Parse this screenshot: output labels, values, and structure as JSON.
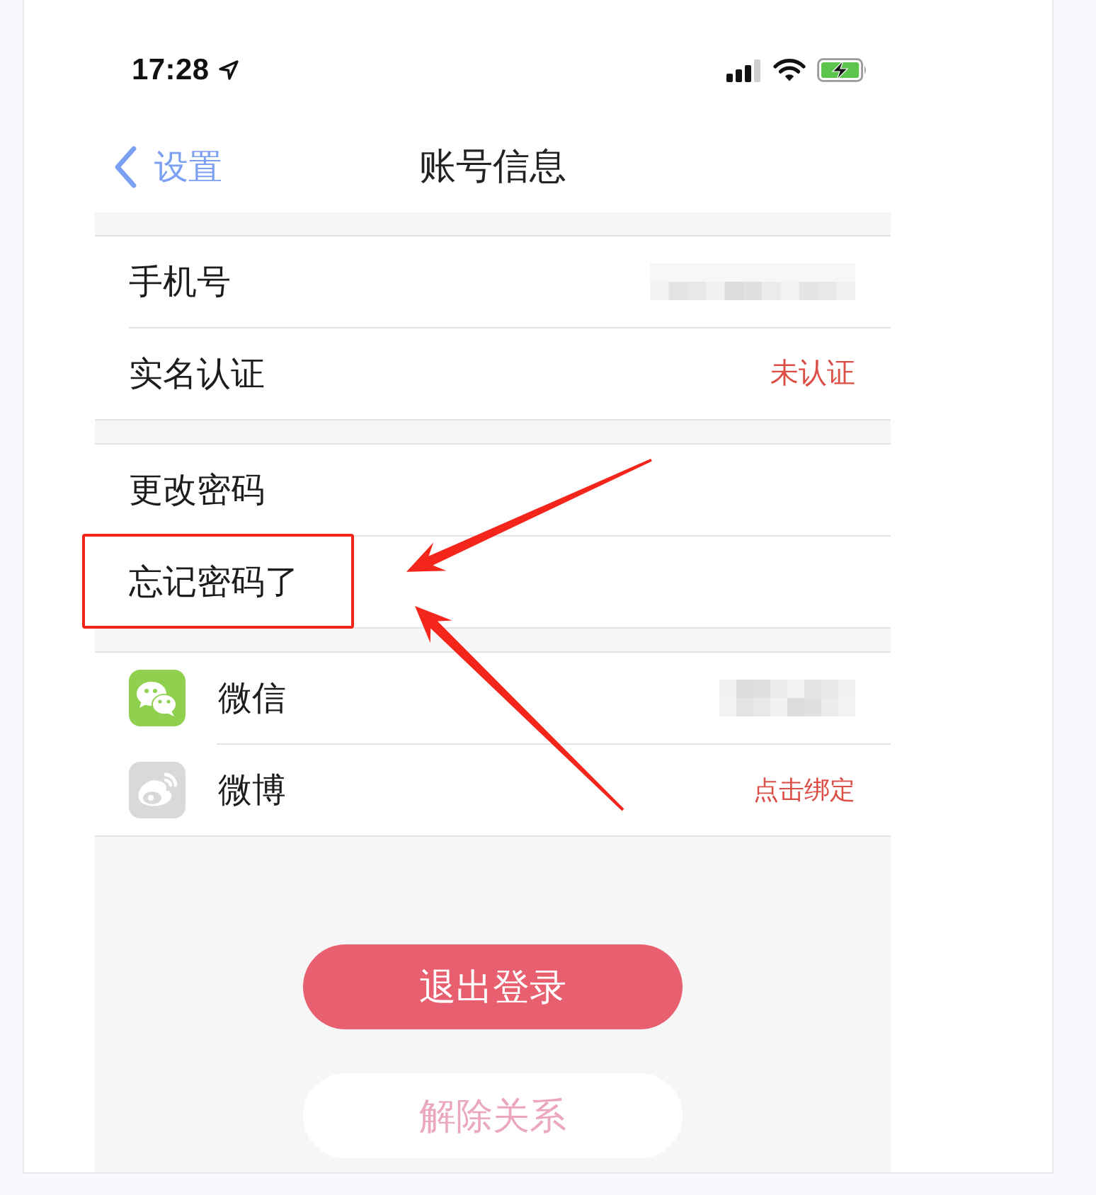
{
  "status_bar": {
    "time": "17:28"
  },
  "nav_bar": {
    "back_label": "设置",
    "title": "账号信息"
  },
  "groups": [
    {
      "rows": [
        {
          "label": "手机号",
          "value": {
            "kind": "blurred"
          },
          "highlighted": false
        },
        {
          "label": "实名认证",
          "value": {
            "kind": "text",
            "text": "未认证"
          },
          "highlighted": false
        }
      ]
    },
    {
      "rows": [
        {
          "label": "更改密码",
          "highlighted": false
        },
        {
          "label": "忘记密码了",
          "highlighted": true
        }
      ]
    },
    {
      "rows": [
        {
          "label": "微信",
          "icon": {
            "kind": "chat",
            "color": "#8fd14f"
          },
          "value": {
            "kind": "blurred"
          },
          "highlighted": false
        },
        {
          "label": "微博",
          "icon": {
            "kind": "swirl",
            "color": "#d9d9d9"
          },
          "value": {
            "kind": "text",
            "text": "点击绑定"
          },
          "highlighted": false
        }
      ]
    }
  ],
  "buttons": [
    {
      "label": "退出登录",
      "kind": "primary"
    },
    {
      "label": "解除关系",
      "kind": "secondary"
    }
  ]
}
